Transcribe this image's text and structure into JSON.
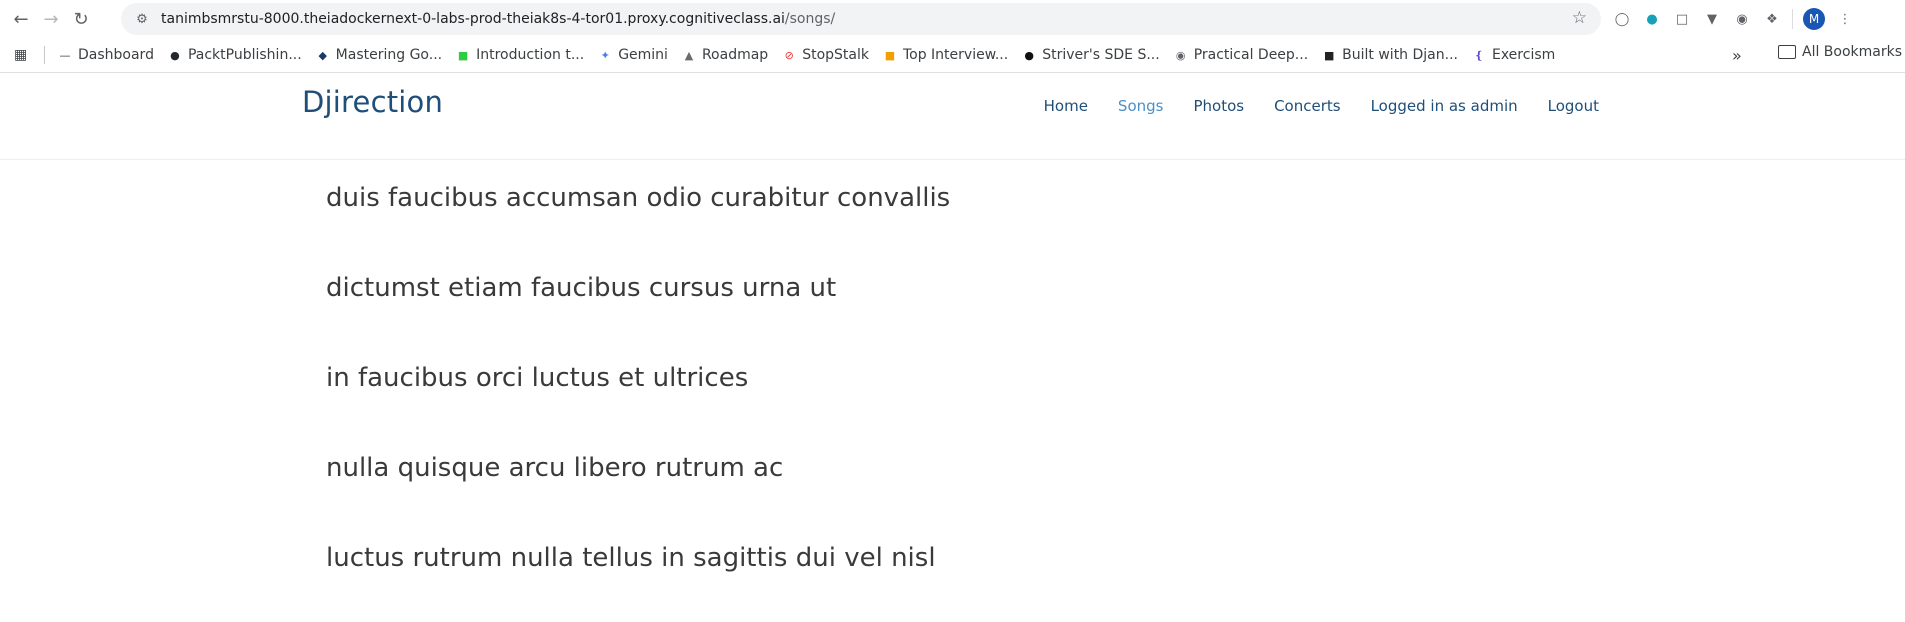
{
  "browser": {
    "url_host": "tanimbsmrstu-8000.theiadockernext-0-labs-prod-theiak8s-4-tor01.proxy.cognitiveclass.ai",
    "url_path": "/songs/",
    "profile_initial": "M"
  },
  "bookmarks": [
    {
      "label": "Dashboard",
      "icon": "dashboard-icon",
      "color": "#3c4043"
    },
    {
      "label": "PacktPublishin...",
      "icon": "github-icon",
      "color": "#24292e"
    },
    {
      "label": "Mastering Go...",
      "icon": "gopher-icon",
      "color": "#1a3a6b"
    },
    {
      "label": "Introduction t...",
      "icon": "leetcode-icon",
      "color": "#2ecc40"
    },
    {
      "label": "Gemini",
      "icon": "gemini-icon",
      "color": "#4a7cf4"
    },
    {
      "label": "Roadmap",
      "icon": "rocket-icon",
      "color": "#6b6b6b"
    },
    {
      "label": "StopStalk",
      "icon": "stopstalk-icon",
      "color": "#e53935"
    },
    {
      "label": "Top Interview...",
      "icon": "leetcode-icon",
      "color": "#f0a000"
    },
    {
      "label": "Striver's SDE S...",
      "icon": "tuf-icon",
      "color": "#111111"
    },
    {
      "label": "Practical Deep...",
      "icon": "globe-icon",
      "color": "#5f6368"
    },
    {
      "label": "Built with Djan...",
      "icon": "django-icon",
      "color": "#222222"
    },
    {
      "label": "Exercism",
      "icon": "exercism-icon",
      "color": "#604fcd"
    }
  ],
  "all_bookmarks_label": "All Bookmarks",
  "site": {
    "brand": "Djirection",
    "nav": [
      "Home",
      "Songs",
      "Photos",
      "Concerts",
      "Logged in as admin",
      "Logout"
    ],
    "active_nav": "Songs"
  },
  "songs": [
    "duis faucibus accumsan odio curabitur convallis",
    "dictumst etiam faucibus cursus urna ut",
    "in faucibus orci luctus et ultrices",
    "nulla quisque arcu libero rutrum ac",
    "luctus rutrum nulla tellus in sagittis dui vel nisl"
  ]
}
